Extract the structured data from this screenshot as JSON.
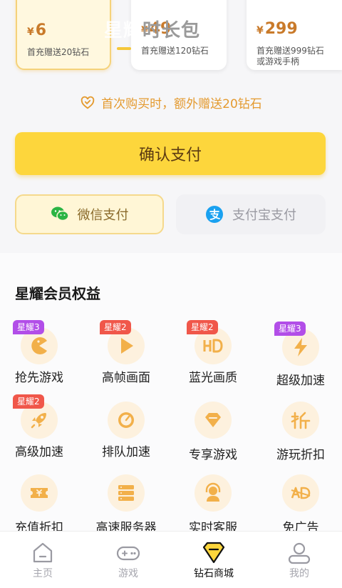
{
  "packages": [
    {
      "currency": "¥",
      "price": "6",
      "desc_lines": [
        "首充赠送20钻石"
      ],
      "selected": true
    },
    {
      "currency": "¥",
      "price": "49",
      "desc_lines": [
        "首充赠送120钻石"
      ],
      "selected": false
    },
    {
      "currency": "¥",
      "price": "299",
      "desc_lines": [
        "首充赠送999钻石",
        "或游戏手柄"
      ],
      "selected": false
    }
  ],
  "overlay_title": {
    "faded": "星耀",
    "tail": "时长包"
  },
  "notice": {
    "text": "首次购买时，额外赠送20钻石",
    "icon": "heart-gift-icon"
  },
  "confirm_button": {
    "label": "确认支付"
  },
  "payment_methods": [
    {
      "label": "微信支付",
      "icon": "wechat-icon",
      "selected": true
    },
    {
      "label": "支付宝支付",
      "icon": "alipay-icon",
      "selected": false
    }
  ],
  "benefits_section": {
    "title": "星耀会员权益",
    "items": [
      {
        "label": "抢先游戏",
        "icon": "pacman-icon",
        "badge": "星耀3",
        "badge_color": "#b24ee8"
      },
      {
        "label": "高帧画面",
        "icon": "play-icon",
        "badge": "星耀2",
        "badge_color": "#f0574a"
      },
      {
        "label": "蓝光画质",
        "icon": "hd-icon",
        "badge": "星耀2",
        "badge_color": "#f0574a"
      },
      {
        "label": "超级加速",
        "icon": "lightning-icon",
        "badge": "星耀3",
        "badge_color": "#b24ee8"
      },
      {
        "label": "高级加速",
        "icon": "rocket-icon",
        "badge": "星耀2",
        "badge_color": "#f0574a"
      },
      {
        "label": "排队加速",
        "icon": "speedometer-icon",
        "badge": "",
        "badge_color": ""
      },
      {
        "label": "专享游戏",
        "icon": "gem-icon",
        "badge": "",
        "badge_color": ""
      },
      {
        "label": "游玩折扣",
        "icon": "discount-icon",
        "badge": "",
        "badge_color": ""
      },
      {
        "label": "充值折扣",
        "icon": "ticket-icon",
        "badge": "",
        "badge_color": ""
      },
      {
        "label": "高速服务器",
        "icon": "server-icon",
        "badge": "",
        "badge_color": ""
      },
      {
        "label": "实时客服",
        "icon": "headset-icon",
        "badge": "",
        "badge_color": ""
      },
      {
        "label": "免广告",
        "icon": "no-ads-icon",
        "badge": "",
        "badge_color": ""
      }
    ]
  },
  "bottom_nav": [
    {
      "label": "主页",
      "icon": "home-icon",
      "active": false
    },
    {
      "label": "游戏",
      "icon": "gamepad-icon",
      "active": false
    },
    {
      "label": "钻石商城",
      "icon": "diamond-shop-icon",
      "active": true
    },
    {
      "label": "我的",
      "icon": "profile-icon",
      "active": false
    }
  ],
  "colors": {
    "accent_yellow": "#fdd63c",
    "price_orange": "#c97a2a",
    "notice_orange": "#e49a2f",
    "badge_purple": "#b24ee8",
    "badge_red": "#f0574a"
  }
}
